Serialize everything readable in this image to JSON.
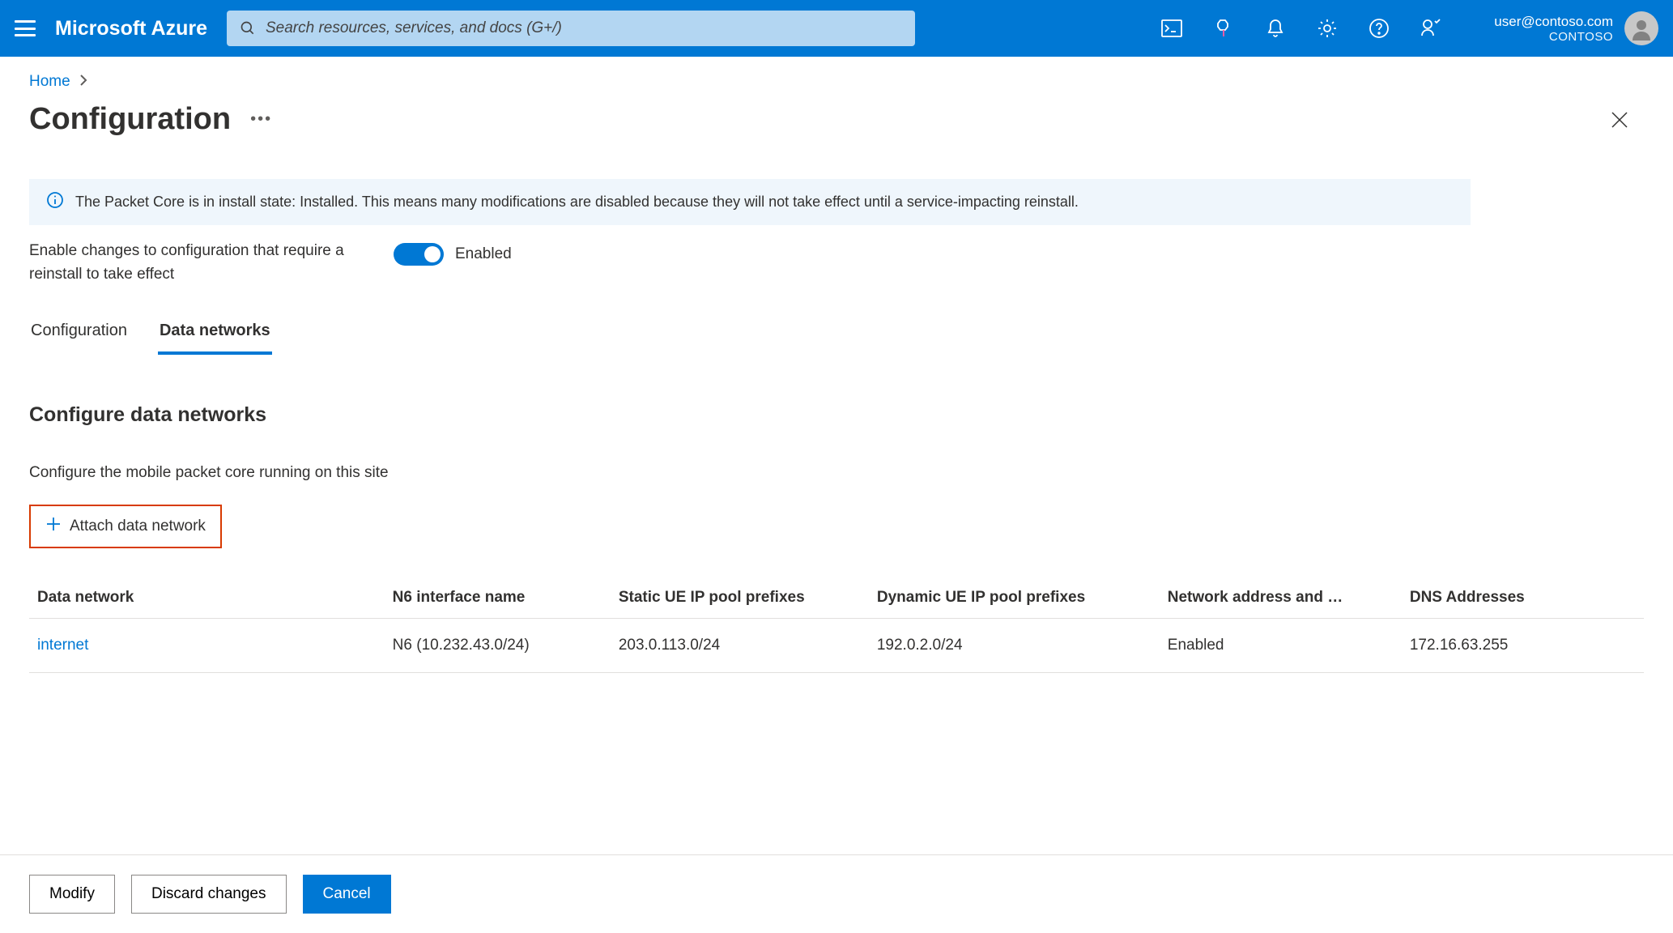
{
  "topbar": {
    "brand": "Microsoft Azure",
    "search_placeholder": "Search resources, services, and docs (G+/)",
    "account": {
      "email": "user@contoso.com",
      "directory": "CONTOSO"
    }
  },
  "breadcrumb": {
    "home": "Home"
  },
  "page": {
    "title": "Configuration"
  },
  "info_banner": "The Packet Core is in install state: Installed. This means many modifications are disabled because they will not take effect until a service-impacting reinstall.",
  "toggle": {
    "label": "Enable changes to configuration that require a reinstall to take effect",
    "state": "Enabled"
  },
  "tabs": [
    {
      "label": "Configuration",
      "active": false
    },
    {
      "label": "Data networks",
      "active": true
    }
  ],
  "section": {
    "title": "Configure data networks",
    "description": "Configure the mobile packet core running on this site",
    "attach_label": "Attach data network"
  },
  "table": {
    "columns": [
      "Data network",
      "N6 interface name",
      "Static UE IP pool prefixes",
      "Dynamic UE IP pool prefixes",
      "Network address and …",
      "DNS Addresses"
    ],
    "rows": [
      {
        "data_network": "internet",
        "n6": "N6 (10.232.43.0/24)",
        "static": "203.0.113.0/24",
        "dynamic": "192.0.2.0/24",
        "nat": "Enabled",
        "dns": "172.16.63.255"
      }
    ]
  },
  "footer": {
    "modify": "Modify",
    "discard": "Discard changes",
    "cancel": "Cancel"
  }
}
